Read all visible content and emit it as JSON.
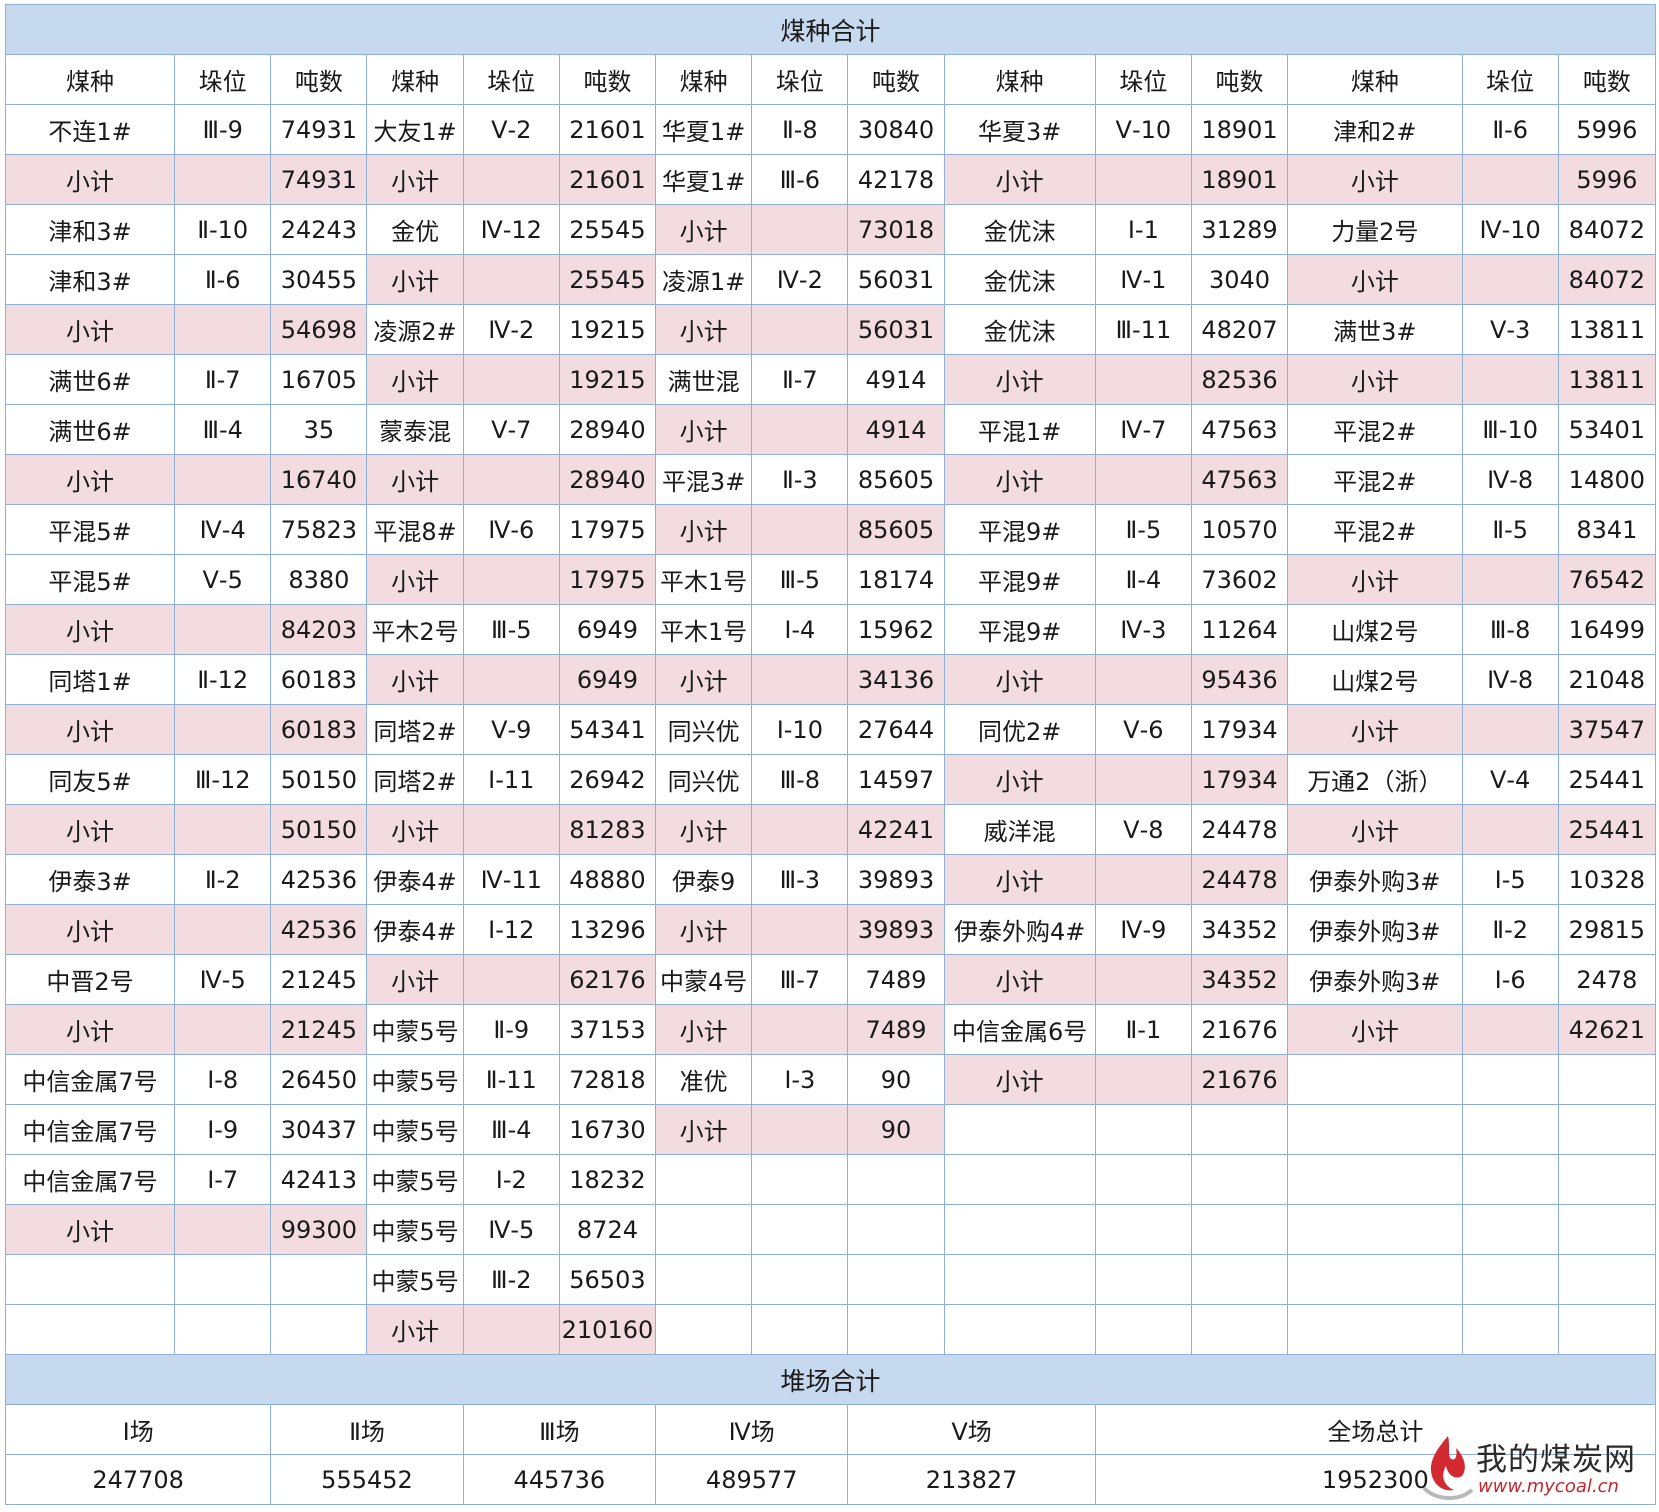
{
  "section1_title": "煤种合计",
  "column_headers": [
    "煤种",
    "垛位",
    "吨数",
    "煤种",
    "垛位",
    "吨数",
    "煤种",
    "垛位",
    "吨数",
    "煤种",
    "垛位",
    "吨数",
    "煤种",
    "垛位",
    "吨数"
  ],
  "rows": [
    [
      [
        "不连1#",
        "Ⅲ-9",
        "74931"
      ],
      [
        "大友1#",
        "Ⅴ-2",
        "21601"
      ],
      [
        "华夏1#",
        "Ⅱ-8",
        "30840"
      ],
      [
        "华夏3#",
        "Ⅴ-10",
        "18901"
      ],
      [
        "津和2#",
        "Ⅱ-6",
        "5996"
      ]
    ],
    [
      [
        "小计",
        "",
        "74931"
      ],
      [
        "小计",
        "",
        "21601"
      ],
      [
        "华夏1#",
        "Ⅲ-6",
        "42178"
      ],
      [
        "小计",
        "",
        "18901"
      ],
      [
        "小计",
        "",
        "5996"
      ]
    ],
    [
      [
        "津和3#",
        "Ⅱ-10",
        "24243"
      ],
      [
        "金优",
        "Ⅳ-12",
        "25545"
      ],
      [
        "小计",
        "",
        "73018"
      ],
      [
        "金优沫",
        "Ⅰ-1",
        "31289"
      ],
      [
        "力量2号",
        "Ⅳ-10",
        "84072"
      ]
    ],
    [
      [
        "津和3#",
        "Ⅱ-6",
        "30455"
      ],
      [
        "小计",
        "",
        "25545"
      ],
      [
        "凌源1#",
        "Ⅳ-2",
        "56031"
      ],
      [
        "金优沫",
        "Ⅳ-1",
        "3040"
      ],
      [
        "小计",
        "",
        "84072"
      ]
    ],
    [
      [
        "小计",
        "",
        "54698"
      ],
      [
        "凌源2#",
        "Ⅳ-2",
        "19215"
      ],
      [
        "小计",
        "",
        "56031"
      ],
      [
        "金优沫",
        "Ⅲ-11",
        "48207"
      ],
      [
        "满世3#",
        "Ⅴ-3",
        "13811"
      ]
    ],
    [
      [
        "满世6#",
        "Ⅱ-7",
        "16705"
      ],
      [
        "小计",
        "",
        "19215"
      ],
      [
        "满世混",
        "Ⅱ-7",
        "4914"
      ],
      [
        "小计",
        "",
        "82536"
      ],
      [
        "小计",
        "",
        "13811"
      ]
    ],
    [
      [
        "满世6#",
        "Ⅲ-4",
        "35"
      ],
      [
        "蒙泰混",
        "Ⅴ-7",
        "28940"
      ],
      [
        "小计",
        "",
        "4914"
      ],
      [
        "平混1#",
        "Ⅳ-7",
        "47563"
      ],
      [
        "平混2#",
        "Ⅲ-10",
        "53401"
      ]
    ],
    [
      [
        "小计",
        "",
        "16740"
      ],
      [
        "小计",
        "",
        "28940"
      ],
      [
        "平混3#",
        "Ⅱ-3",
        "85605"
      ],
      [
        "小计",
        "",
        "47563"
      ],
      [
        "平混2#",
        "Ⅳ-8",
        "14800"
      ]
    ],
    [
      [
        "平混5#",
        "Ⅳ-4",
        "75823"
      ],
      [
        "平混8#",
        "Ⅳ-6",
        "17975"
      ],
      [
        "小计",
        "",
        "85605"
      ],
      [
        "平混9#",
        "Ⅱ-5",
        "10570"
      ],
      [
        "平混2#",
        "Ⅱ-5",
        "8341"
      ]
    ],
    [
      [
        "平混5#",
        "Ⅴ-5",
        "8380"
      ],
      [
        "小计",
        "",
        "17975"
      ],
      [
        "平木1号",
        "Ⅲ-5",
        "18174"
      ],
      [
        "平混9#",
        "Ⅱ-4",
        "73602"
      ],
      [
        "小计",
        "",
        "76542"
      ]
    ],
    [
      [
        "小计",
        "",
        "84203"
      ],
      [
        "平木2号",
        "Ⅲ-5",
        "6949"
      ],
      [
        "平木1号",
        "Ⅰ-4",
        "15962"
      ],
      [
        "平混9#",
        "Ⅳ-3",
        "11264"
      ],
      [
        "山煤2号",
        "Ⅲ-8",
        "16499"
      ]
    ],
    [
      [
        "同塔1#",
        "Ⅱ-12",
        "60183"
      ],
      [
        "小计",
        "",
        "6949"
      ],
      [
        "小计",
        "",
        "34136"
      ],
      [
        "小计",
        "",
        "95436"
      ],
      [
        "山煤2号",
        "Ⅳ-8",
        "21048"
      ]
    ],
    [
      [
        "小计",
        "",
        "60183"
      ],
      [
        "同塔2#",
        "Ⅴ-9",
        "54341"
      ],
      [
        "同兴优",
        "Ⅰ-10",
        "27644"
      ],
      [
        "同优2#",
        "Ⅴ-6",
        "17934"
      ],
      [
        "小计",
        "",
        "37547"
      ]
    ],
    [
      [
        "同友5#",
        "Ⅲ-12",
        "50150"
      ],
      [
        "同塔2#",
        "Ⅰ-11",
        "26942"
      ],
      [
        "同兴优",
        "Ⅲ-8",
        "14597"
      ],
      [
        "小计",
        "",
        "17934"
      ],
      [
        "万通2（浙）",
        "Ⅴ-4",
        "25441"
      ]
    ],
    [
      [
        "小计",
        "",
        "50150"
      ],
      [
        "小计",
        "",
        "81283"
      ],
      [
        "小计",
        "",
        "42241"
      ],
      [
        "威洋混",
        "Ⅴ-8",
        "24478"
      ],
      [
        "小计",
        "",
        "25441"
      ]
    ],
    [
      [
        "伊泰3#",
        "Ⅱ-2",
        "42536"
      ],
      [
        "伊泰4#",
        "Ⅳ-11",
        "48880"
      ],
      [
        "伊泰9",
        "Ⅲ-3",
        "39893"
      ],
      [
        "小计",
        "",
        "24478"
      ],
      [
        "伊泰外购3#",
        "Ⅰ-5",
        "10328"
      ]
    ],
    [
      [
        "小计",
        "",
        "42536"
      ],
      [
        "伊泰4#",
        "Ⅰ-12",
        "13296"
      ],
      [
        "小计",
        "",
        "39893"
      ],
      [
        "伊泰外购4#",
        "Ⅳ-9",
        "34352"
      ],
      [
        "伊泰外购3#",
        "Ⅱ-2",
        "29815"
      ]
    ],
    [
      [
        "中晋2号",
        "Ⅳ-5",
        "21245"
      ],
      [
        "小计",
        "",
        "62176"
      ],
      [
        "中蒙4号",
        "Ⅲ-7",
        "7489"
      ],
      [
        "小计",
        "",
        "34352"
      ],
      [
        "伊泰外购3#",
        "Ⅰ-6",
        "2478"
      ]
    ],
    [
      [
        "小计",
        "",
        "21245"
      ],
      [
        "中蒙5号",
        "Ⅱ-9",
        "37153"
      ],
      [
        "小计",
        "",
        "7489"
      ],
      [
        "中信金属6号",
        "Ⅱ-1",
        "21676"
      ],
      [
        "小计",
        "",
        "42621"
      ]
    ],
    [
      [
        "中信金属7号",
        "Ⅰ-8",
        "26450"
      ],
      [
        "中蒙5号",
        "Ⅱ-11",
        "72818"
      ],
      [
        "准优",
        "Ⅰ-3",
        "90"
      ],
      [
        "小计",
        "",
        "21676"
      ],
      [
        "",
        "",
        ""
      ]
    ],
    [
      [
        "中信金属7号",
        "Ⅰ-9",
        "30437"
      ],
      [
        "中蒙5号",
        "Ⅲ-4",
        "16730"
      ],
      [
        "小计",
        "",
        "90"
      ],
      [
        "",
        "",
        ""
      ],
      [
        "",
        "",
        ""
      ]
    ],
    [
      [
        "中信金属7号",
        "Ⅰ-7",
        "42413"
      ],
      [
        "中蒙5号",
        "Ⅰ-2",
        "18232"
      ],
      [
        "",
        "",
        ""
      ],
      [
        "",
        "",
        ""
      ],
      [
        "",
        "",
        ""
      ]
    ],
    [
      [
        "小计",
        "",
        "99300"
      ],
      [
        "中蒙5号",
        "Ⅳ-5",
        "8724"
      ],
      [
        "",
        "",
        ""
      ],
      [
        "",
        "",
        ""
      ],
      [
        "",
        "",
        ""
      ]
    ],
    [
      [
        "",
        "",
        ""
      ],
      [
        "中蒙5号",
        "Ⅲ-2",
        "56503"
      ],
      [
        "",
        "",
        ""
      ],
      [
        "",
        "",
        ""
      ],
      [
        "",
        "",
        ""
      ]
    ],
    [
      [
        "",
        "",
        ""
      ],
      [
        "小计",
        "",
        "210160"
      ],
      [
        "",
        "",
        ""
      ],
      [
        "",
        "",
        ""
      ],
      [
        "",
        "",
        ""
      ]
    ]
  ],
  "section2_title": "堆场合计",
  "yard_headers": [
    "Ⅰ场",
    "Ⅱ场",
    "Ⅲ场",
    "Ⅳ场",
    "Ⅴ场",
    "全场总计"
  ],
  "yard_values": [
    "247708",
    "555452",
    "445736",
    "489577",
    "213827",
    "1952300"
  ],
  "watermark": {
    "name": "我的煤炭网",
    "url": "www.mycoal.cn"
  },
  "colors": {
    "header_bg": "#c7d9ef",
    "subtotal_bg": "#f2dcdf",
    "border": "#8fb0d6"
  }
}
